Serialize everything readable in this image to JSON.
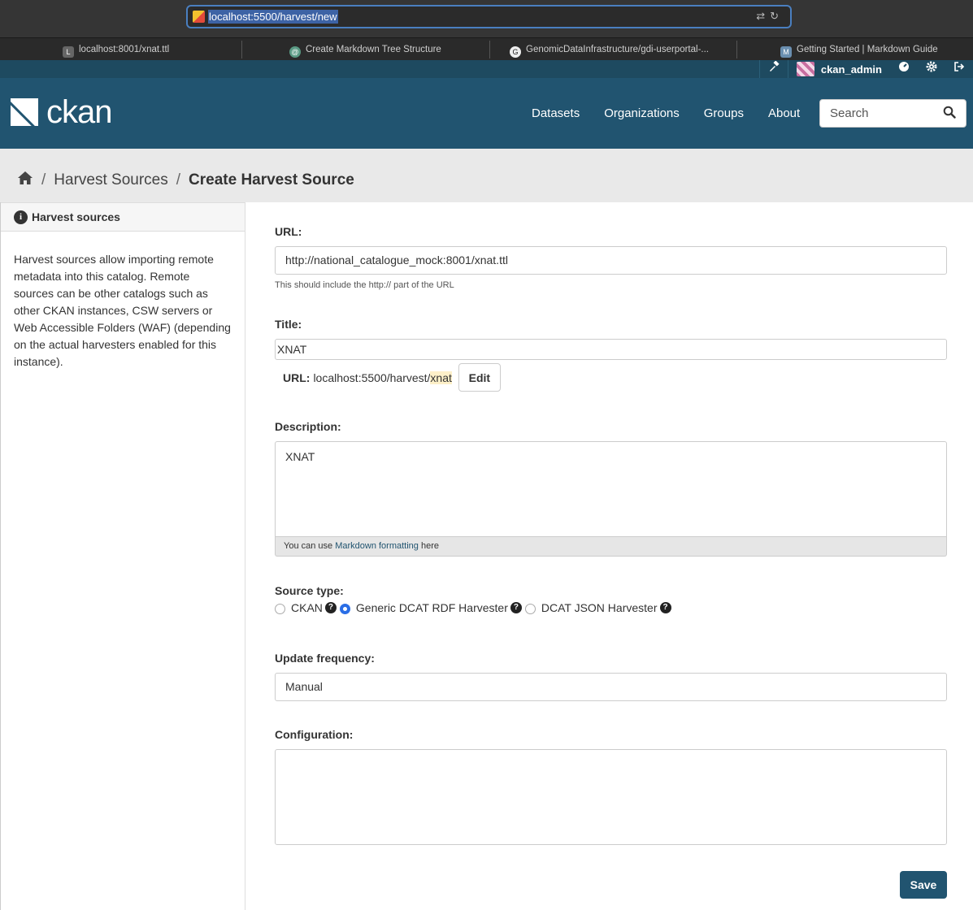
{
  "browser": {
    "url": "localhost:5500/harvest/new",
    "tabs": [
      {
        "label": "localhost:8001/xnat.ttl",
        "fav": "L"
      },
      {
        "label": "Create Markdown Tree Structure",
        "fav": "@"
      },
      {
        "label": "GenomicDataInfrastructure/gdi-userportal-...",
        "fav": "G"
      },
      {
        "label": "Getting Started | Markdown Guide",
        "fav": "M"
      }
    ]
  },
  "account": {
    "username": "ckan_admin"
  },
  "header": {
    "logo": "ckan",
    "nav": [
      "Datasets",
      "Organizations",
      "Groups",
      "About"
    ],
    "search_placeholder": "Search"
  },
  "breadcrumb": {
    "items": [
      "Harvest Sources",
      "Create Harvest Source"
    ]
  },
  "sidebar": {
    "heading": "Harvest sources",
    "text": "Harvest sources allow importing remote metadata into this catalog. Remote sources can be other catalogs such as other CKAN instances, CSW servers or Web Accessible Folders (WAF) (depending on the actual harvesters enabled for this instance)."
  },
  "form": {
    "url_label": "URL:",
    "url_value": "http://national_catalogue_mock:8001/xnat.ttl",
    "url_help": "This should include the http:// part of the URL",
    "title_label": "Title:",
    "title_value": "XNAT",
    "slug_label": "URL:",
    "slug_prefix": "localhost:5500/harvest/",
    "slug_value": "xnat",
    "edit_label": "Edit",
    "description_label": "Description:",
    "description_value": "XNAT",
    "markdown_before": "You can use ",
    "markdown_link": "Markdown formatting",
    "markdown_after": " here",
    "source_type_label": "Source type:",
    "source_types": [
      {
        "label": "CKAN",
        "selected": false
      },
      {
        "label": "Generic DCAT RDF Harvester",
        "selected": true
      },
      {
        "label": "DCAT JSON Harvester",
        "selected": false
      }
    ],
    "frequency_label": "Update frequency:",
    "frequency_value": "Manual",
    "config_label": "Configuration:",
    "config_value": "",
    "save_label": "Save"
  }
}
